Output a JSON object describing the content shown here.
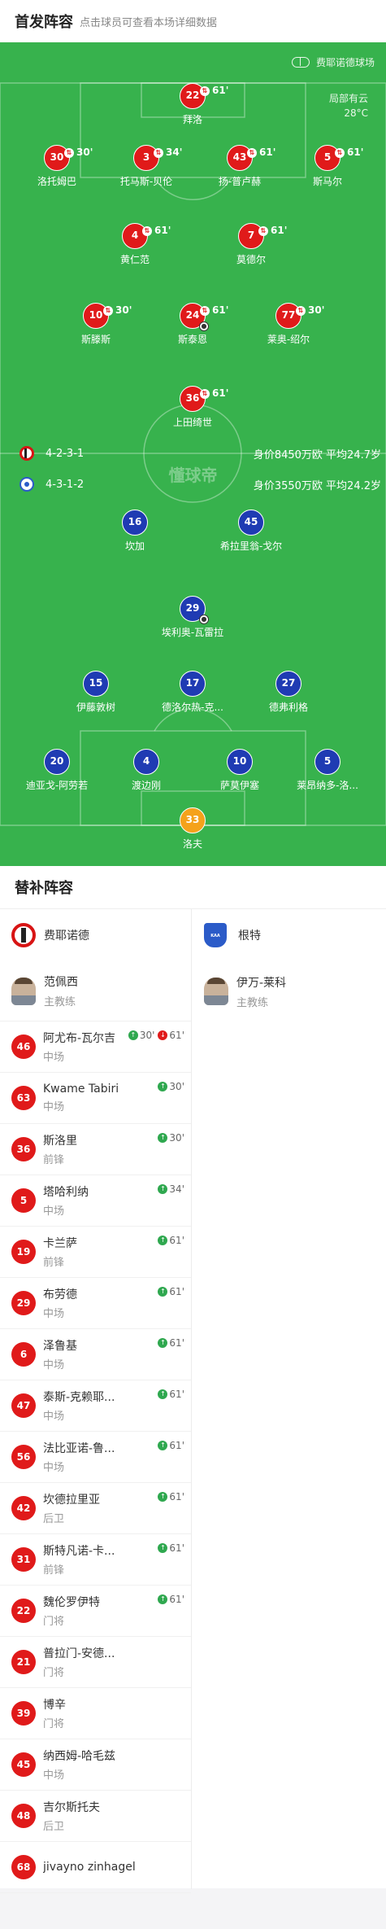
{
  "lineup": {
    "title": "首发阵容",
    "subtitle": "点击球员可查看本场详细数据"
  },
  "venue": "费耶诺德球场",
  "weather": {
    "condition": "局部有云",
    "temp": "28°C"
  },
  "watermark": "懂球帝",
  "home": {
    "formation": "4-2-3-1",
    "value": "身价8450万欧 平均24.7岁",
    "players": [
      {
        "num": "22",
        "name": "拜洛",
        "sub": "61'"
      },
      {
        "num": "30",
        "name": "洛托姆巴",
        "sub": "30'"
      },
      {
        "num": "3",
        "name": "托马斯-贝伦",
        "sub": "34'"
      },
      {
        "num": "43",
        "name": "扬-普卢赫",
        "sub": "61'"
      },
      {
        "num": "5",
        "name": "斯马尔",
        "sub": "61'"
      },
      {
        "num": "4",
        "name": "黄仁范",
        "sub": "61'"
      },
      {
        "num": "7",
        "name": "莫德尔",
        "sub": "61'"
      },
      {
        "num": "10",
        "name": "斯滕斯",
        "sub": "30'"
      },
      {
        "num": "24",
        "name": "斯泰恩",
        "sub": "61'"
      },
      {
        "num": "77",
        "name": "莱奥-绍尔",
        "sub": "30'"
      },
      {
        "num": "36",
        "name": "上田绮世",
        "sub": "61'"
      }
    ]
  },
  "away": {
    "formation": "4-3-1-2",
    "value": "身价3550万欧 平均24.2岁",
    "players": [
      {
        "num": "16",
        "name": "坎加"
      },
      {
        "num": "45",
        "name": "希拉里翁-戈尔"
      },
      {
        "num": "29",
        "name": "埃利奥-瓦雷拉"
      },
      {
        "num": "15",
        "name": "伊藤敦树"
      },
      {
        "num": "17",
        "name": "德洛尔热-克..."
      },
      {
        "num": "27",
        "name": "德弗利格"
      },
      {
        "num": "20",
        "name": "迪亚戈-阿劳若"
      },
      {
        "num": "4",
        "name": "渡边刚"
      },
      {
        "num": "10",
        "name": "萨莫伊塞"
      },
      {
        "num": "5",
        "name": "莱昂纳多-洛..."
      },
      {
        "num": "33",
        "name": "洛夫"
      }
    ]
  },
  "subs": {
    "title": "替补阵容",
    "home": {
      "team": "费耶诺德",
      "coach": "范佩西",
      "coach_role": "主教练",
      "players": [
        {
          "num": "46",
          "name": "阿尤布-瓦尔吉",
          "pos": "中场",
          "in": "30'",
          "out": "61'"
        },
        {
          "num": "63",
          "name": "Kwame Tabiri",
          "pos": "中场",
          "in": "30'"
        },
        {
          "num": "36",
          "name": "斯洛里",
          "pos": "前锋",
          "in": "30'"
        },
        {
          "num": "5",
          "name": "塔哈利纳",
          "pos": "中场",
          "in": "34'"
        },
        {
          "num": "19",
          "name": "卡兰萨",
          "pos": "前锋",
          "in": "61'"
        },
        {
          "num": "29",
          "name": "布劳德",
          "pos": "中场",
          "in": "61'"
        },
        {
          "num": "6",
          "name": "泽鲁基",
          "pos": "中场",
          "in": "61'"
        },
        {
          "num": "47",
          "name": "泰斯-克赖耶...",
          "pos": "中场",
          "in": "61'"
        },
        {
          "num": "56",
          "name": "法比亚诺-鲁...",
          "pos": "中场",
          "in": "61'"
        },
        {
          "num": "42",
          "name": "坎德拉里亚",
          "pos": "后卫",
          "in": "61'"
        },
        {
          "num": "31",
          "name": "斯特凡诺-卡...",
          "pos": "前锋",
          "in": "61'"
        },
        {
          "num": "22",
          "name": "魏伦罗伊特",
          "pos": "门将",
          "in": "61'"
        },
        {
          "num": "21",
          "name": "普拉门-安德...",
          "pos": "门将"
        },
        {
          "num": "39",
          "name": "博辛",
          "pos": "门将"
        },
        {
          "num": "45",
          "name": "纳西姆-哈毛兹",
          "pos": "中场"
        },
        {
          "num": "48",
          "name": "吉尔斯托夫",
          "pos": "后卫"
        },
        {
          "num": "68",
          "name": "jivayno zinhagel",
          "pos": ""
        }
      ]
    },
    "away": {
      "team": "根特",
      "crest_text": "KAA GENT",
      "coach": "伊万-莱科",
      "coach_role": "主教练"
    }
  },
  "colors": {
    "pitch": "#37b24d",
    "home_badge": "#e01a1a",
    "away_badge": "#1f3bb3",
    "gk_away": "#f5a21b",
    "sub_in": "#2fa84f"
  }
}
